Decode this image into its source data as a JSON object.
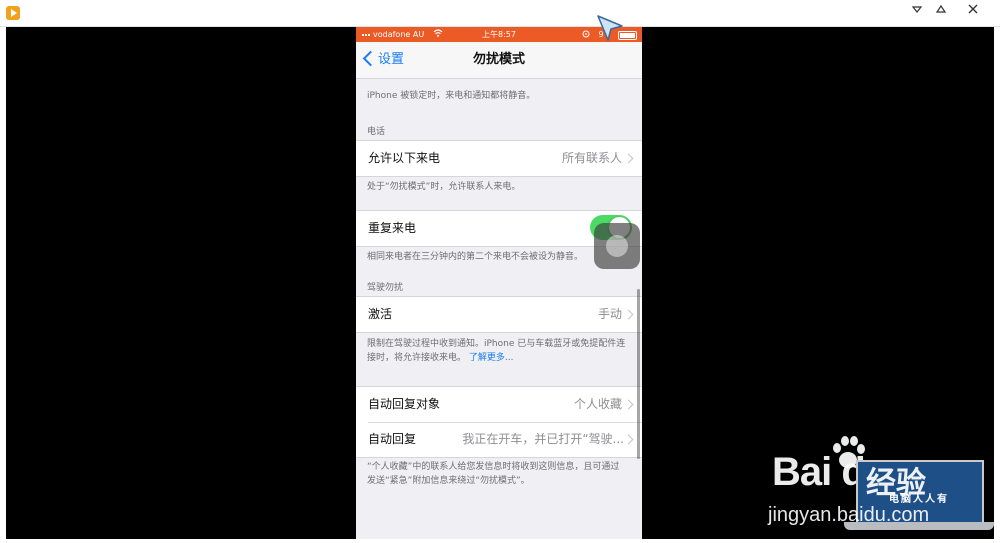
{
  "status_bar": {
    "carrier": "vodafone AU",
    "time": "上午8:57",
    "battery_text": "9"
  },
  "nav": {
    "back_label": "设置",
    "title": "勿扰模式"
  },
  "lock_footer": "iPhone 被锁定时，来电和通知都将静音。",
  "phone_section": {
    "header": "电话",
    "allow_calls_label": "允许以下来电",
    "allow_calls_value": "所有联系人",
    "footer": "处于“勿扰模式”时，允许联系人来电。"
  },
  "repeated_calls": {
    "label": "重复来电",
    "enabled": true,
    "footer": "相同来电者在三分钟内的第二个来电不会被设为静音。"
  },
  "driving_section": {
    "header": "驾驶勿扰",
    "activate_label": "激活",
    "activate_value": "手动",
    "footer": "限制在驾驶过程中收到通知。iPhone 已与车载蓝牙或免提配件连接时，将允许接收来电。",
    "learn_more": "了解更多..."
  },
  "auto_reply": {
    "to_label": "自动回复对象",
    "to_value": "个人收藏",
    "reply_label": "自动回复",
    "reply_value": "我正在开车，并已打开“驾驶...",
    "footer": "“个人收藏”中的联系人给您发信息时将收到这则信息，且可通过发送“紧急”附加信息来绕过“勿扰模式”。"
  },
  "watermark": {
    "brand": "Bai du",
    "product": "经验",
    "url": "jingyan.baidu.com",
    "badge": "电脑人人有"
  },
  "colors": {
    "status_bar": "#ec5b26",
    "accent": "#1a7cf5",
    "toggle_on": "#4cd964"
  },
  "icons": [
    "app-icon",
    "minimize-icon",
    "restore-icon",
    "close-icon",
    "chevron-left-icon",
    "chevron-right-icon",
    "wifi-icon",
    "alarm-icon",
    "battery-icon",
    "cursor-icon",
    "paw-icon"
  ]
}
